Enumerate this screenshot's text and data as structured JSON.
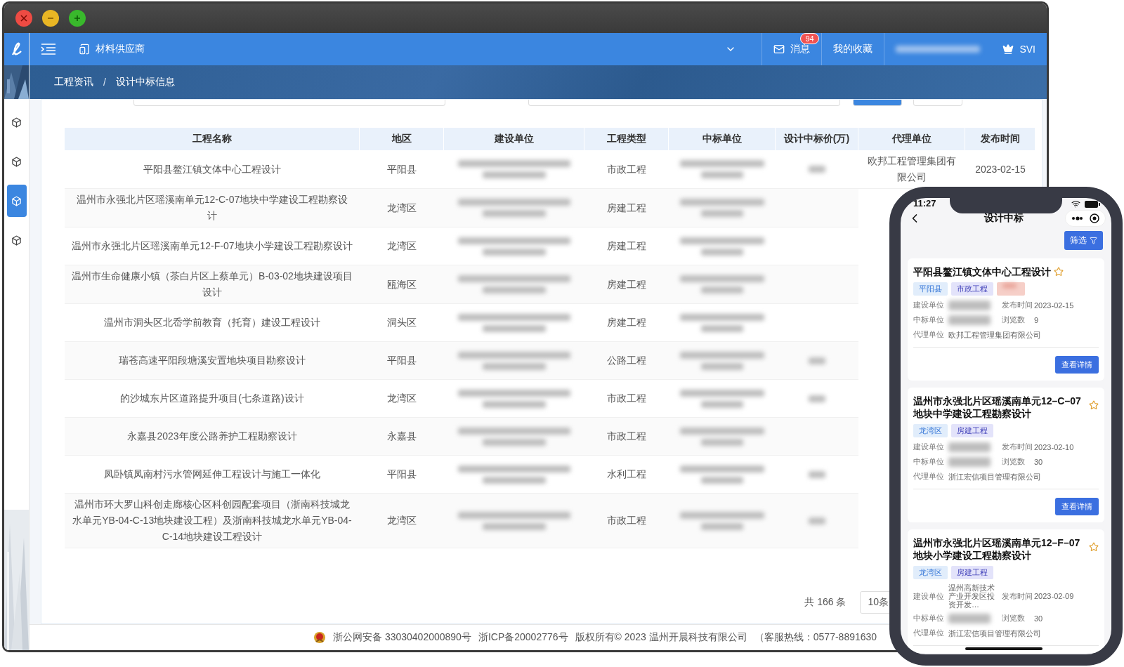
{
  "nav": {
    "role": "材料供应商",
    "messages": {
      "label": "消息",
      "badge": "94"
    },
    "favorites": "我的收藏",
    "user_short": "SVI"
  },
  "breadcrumb": {
    "separator": "/",
    "items": [
      {
        "label": "工程资讯"
      },
      {
        "label": "设计中标信息"
      }
    ]
  },
  "table": {
    "columns": [
      "工程名称",
      "地区",
      "建设单位",
      "工程类型",
      "中标单位",
      "设计中标价(万)",
      "代理单位",
      "发布时间"
    ],
    "rows": [
      {
        "name": "平阳县鳌江镇文体中心工程设计",
        "region": "平阳县",
        "type": "市政工程",
        "price_redacted": true,
        "agency": "欧邦工程管理集团有限公司",
        "date": "2023-02-15"
      },
      {
        "name": "温州市永强北片区瑶溪南单元12-C-07地块中学建设工程勘察设计",
        "region": "龙湾区",
        "type": "房建工程",
        "price_redacted": false
      },
      {
        "name": "温州市永强北片区瑶溪南单元12-F-07地块小学建设工程勘察设计",
        "region": "龙湾区",
        "type": "房建工程",
        "price_redacted": false
      },
      {
        "name": "温州市生命健康小镇（茶白片区上蔡单元）B-03-02地块建设项目设计",
        "region": "瓯海区",
        "type": "房建工程",
        "price_redacted": false
      },
      {
        "name": "温州市洞头区北岙学前教育（托育）建设工程设计",
        "region": "洞头区",
        "type": "房建工程",
        "price_redacted": false
      },
      {
        "name": "瑞苍高速平阳段塘溪安置地块项目勘察设计",
        "region": "平阳县",
        "type": "公路工程",
        "price_redacted": true
      },
      {
        "name": "的沙城东片区道路提升项目(七条道路)设计",
        "region": "龙湾区",
        "type": "市政工程",
        "price_redacted": true
      },
      {
        "name": "永嘉县2023年度公路养护工程勘察设计",
        "region": "永嘉县",
        "type": "市政工程",
        "price_redacted": false
      },
      {
        "name": "凤卧镇凤南村污水管网延伸工程设计与施工一体化",
        "region": "平阳县",
        "type": "水利工程",
        "price_redacted": true
      },
      {
        "name": "温州市环大罗山科创走廊核心区科创园配套项目（浙南科技城龙水单元YB-04-C-13地块建设工程）及浙南科技城龙水单元YB-04-C-14地块建设工程设计",
        "region": "龙湾区",
        "type": "市政工程",
        "price_redacted": true
      }
    ]
  },
  "pagination": {
    "total": "共 166 条",
    "page_size": "10条"
  },
  "footer": [
    "浙公网安备 33030402000890号",
    "浙ICP备20002776号",
    "版权所有© 2023 温州开晨科技有限公司",
    "（客服热线：0577-8891630"
  ],
  "phone": {
    "time": "11:27",
    "title": "设计中标",
    "filter": "筛选",
    "cards": [
      {
        "title": "平阳县鳌江镇文体中心工程设计",
        "tags": [
          {
            "kind": "region",
            "label": "平阳县"
          },
          {
            "kind": "type",
            "label": "市政工程"
          },
          {
            "kind": "redacted"
          }
        ],
        "labels": [
          "建设单位",
          "发布时间",
          "中标单位",
          "浏览数",
          "代理单位"
        ],
        "date": "2023-02-15",
        "views": "9",
        "agency": "欧邦工程管理集团有限公司",
        "button": "查看详情"
      },
      {
        "title": "温州市永强北片区瑶溪南单元12–C–07地块中学建设工程勘察设计",
        "tags": [
          {
            "kind": "region",
            "label": "龙湾区"
          },
          {
            "kind": "type",
            "label": "房建工程"
          }
        ],
        "labels": [
          "建设单位",
          "发布时间",
          "中标单位",
          "浏览数",
          "代理单位"
        ],
        "date": "2023-02-10",
        "views": "30",
        "agency": "浙江宏信项目管理有限公司",
        "button": "查看详情"
      },
      {
        "title": "温州市永强北片区瑶溪南单元12–F–07地块小学建设工程勘察设计",
        "tags": [
          {
            "kind": "region",
            "label": "龙湾区"
          },
          {
            "kind": "type",
            "label": "房建工程"
          }
        ],
        "labels": [
          "建设单位",
          "发布时间",
          "中标单位",
          "浏览数",
          "代理单位"
        ],
        "builder": "温州高新技术产业开发区投资开发…",
        "date": "2023-02-09",
        "views": "30",
        "agency": "浙江宏信项目管理有限公司"
      }
    ]
  }
}
